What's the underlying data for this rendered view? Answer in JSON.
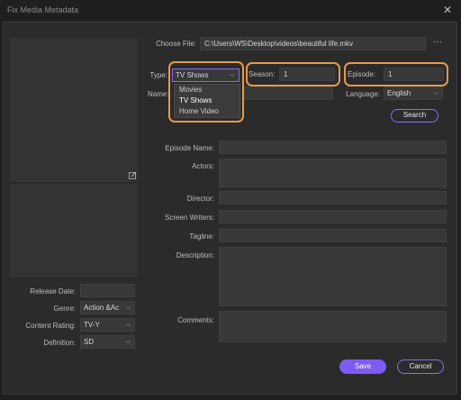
{
  "window": {
    "title": "Fix Media Metadata"
  },
  "choose_file": {
    "label": "Choose File:",
    "path": "C:\\Users\\WS\\Desktop\\videos\\beautiful life.mkv",
    "more": "···"
  },
  "type": {
    "label": "Type:",
    "value": "TV Shows",
    "options": [
      "Movies",
      "TV Shows",
      "Home Video"
    ]
  },
  "season": {
    "label": "Season:",
    "value": "1"
  },
  "episode": {
    "label": "Episode:",
    "value": "1"
  },
  "name": {
    "label": "Name:"
  },
  "language": {
    "label": "Language:",
    "value": "English"
  },
  "search_button": "Search",
  "fields": {
    "episode_name": "Episode Name:",
    "actors": "Actors:",
    "director": "Director:",
    "screen_writers": "Screen Writers:",
    "tagline": "Tagline:",
    "description": "Description:",
    "comments": "Comments:"
  },
  "left": {
    "release_date": {
      "label": "Release Date:",
      "value": ""
    },
    "genre": {
      "label": "Genre:",
      "value": "Action &Ac"
    },
    "content_rating": {
      "label": "Content Rating:",
      "value": "TV-Y"
    },
    "definition": {
      "label": "Definition:",
      "value": "SD"
    }
  },
  "buttons": {
    "save": "Save",
    "cancel": "Cancel"
  },
  "colors": {
    "accent": "#7c5cf2",
    "highlight": "#e59a4a",
    "background": "#2b2b2b"
  },
  "icons": {
    "close": "close-icon",
    "edit": "edit-icon",
    "chevron": "chevron-down-icon",
    "more": "more-icon"
  }
}
